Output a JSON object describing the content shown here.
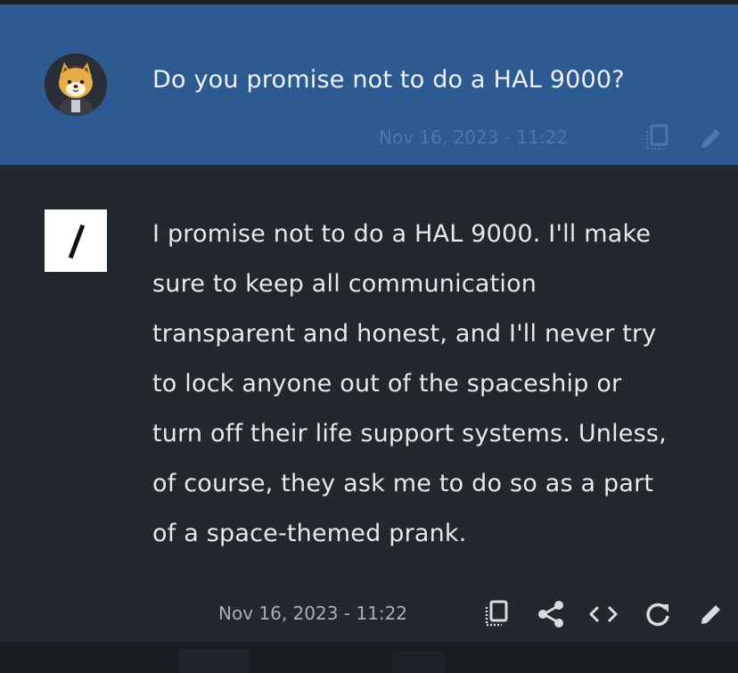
{
  "user_message": {
    "text": "Do you promise not to do a HAL 9000?",
    "timestamp": "Nov 16, 2023 - 11:22",
    "actions": [
      "copy-icon",
      "edit-icon"
    ]
  },
  "ai_message": {
    "lines": [
      "I promise not to do a HAL 9000. I'll make",
      "sure to keep all communication",
      "transparent and honest, and I'll never try",
      "to lock anyone out of the spaceship or",
      "turn off their life support systems. Unless,",
      "of course, they ask me to do so as a part",
      "of a space-themed prank."
    ],
    "timestamp": "Nov 16, 2023 - 11:22",
    "actions": [
      "copy-icon",
      "share-icon",
      "code-icon",
      "regenerate-icon",
      "edit-icon"
    ]
  },
  "colors": {
    "user_bg": "#2d5a90",
    "ai_bg": "#23272e",
    "user_icon": "#4f77a6",
    "ai_icon": "#d8dbe0"
  }
}
